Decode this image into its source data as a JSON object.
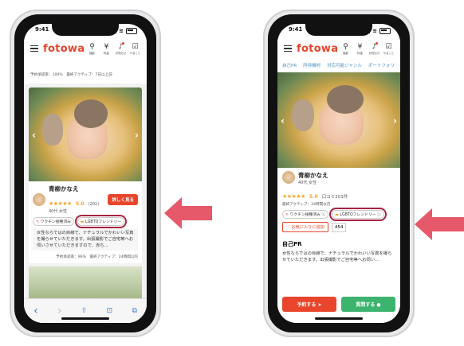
{
  "colors": {
    "brand": "#e8452c",
    "highlight": "#a8233f",
    "arrow": "#e5596a",
    "star": "#f5a623",
    "green": "#3cb46e",
    "link": "#4a90c2"
  },
  "status": {
    "time": "9:41"
  },
  "header": {
    "logo": "fotowa",
    "icons": [
      {
        "icon": "search-icon",
        "glyph": "⚲",
        "label": "撮影"
      },
      {
        "icon": "yen-icon",
        "glyph": "¥",
        "label": "料金"
      },
      {
        "icon": "bell-icon",
        "glyph": "♫",
        "label": "お知らせ"
      },
      {
        "icon": "checkbox-icon",
        "glyph": "☑",
        "label": "やること"
      }
    ]
  },
  "left": {
    "top_snippet": "予約承諾率：100%　最終アクティブ：7日以上前",
    "photographer": {
      "name": "青柳かなえ",
      "stars": "★★★★★",
      "rating": "5.0",
      "reviews": "(201)",
      "meta": "40代 女性",
      "detail_button": "詳しく見る",
      "tag_vaccine": "ワクチン接種済み",
      "tag_lgbtq": "LGBTQフレンドリー",
      "description": "女性ならではの目線で、ナチュラルでかわいい写真を撮らせていただきます。出張撮影でご自宅等へお伺いさせていただきますので、赤ち...",
      "footer": "予約承諾率：96%　最終アクティブ：24時間以内"
    },
    "bottom_nav": {
      "back": "‹",
      "forward": "›",
      "share": "⇧",
      "bookmarks": "⊡",
      "tabs": "⧉"
    }
  },
  "right": {
    "tabs": [
      "自己PR",
      "所持機材",
      "対応可能ジャンル",
      "ポートフォリ"
    ],
    "photographer": {
      "name": "青柳かなえ",
      "meta": "40代 女性",
      "stars": "★★★★★",
      "rating": "5.0",
      "reviews": "口コミ201件",
      "last_active": "最終アクティブ：24時間以内",
      "tag_vaccine": "ワクチン接種済み",
      "tag_lgbtq": "LGBTQフレンドリー",
      "favorite": "お気に入りに追加",
      "favorite_count": "454",
      "section_title": "自己PR",
      "description": "女性ならではの目線で、ナチュラルでかわいい写真を撮らせていただきます。出張撮影でご自宅等へお伺い...",
      "reserve_button": "予約する",
      "question_button": "質問する"
    }
  }
}
